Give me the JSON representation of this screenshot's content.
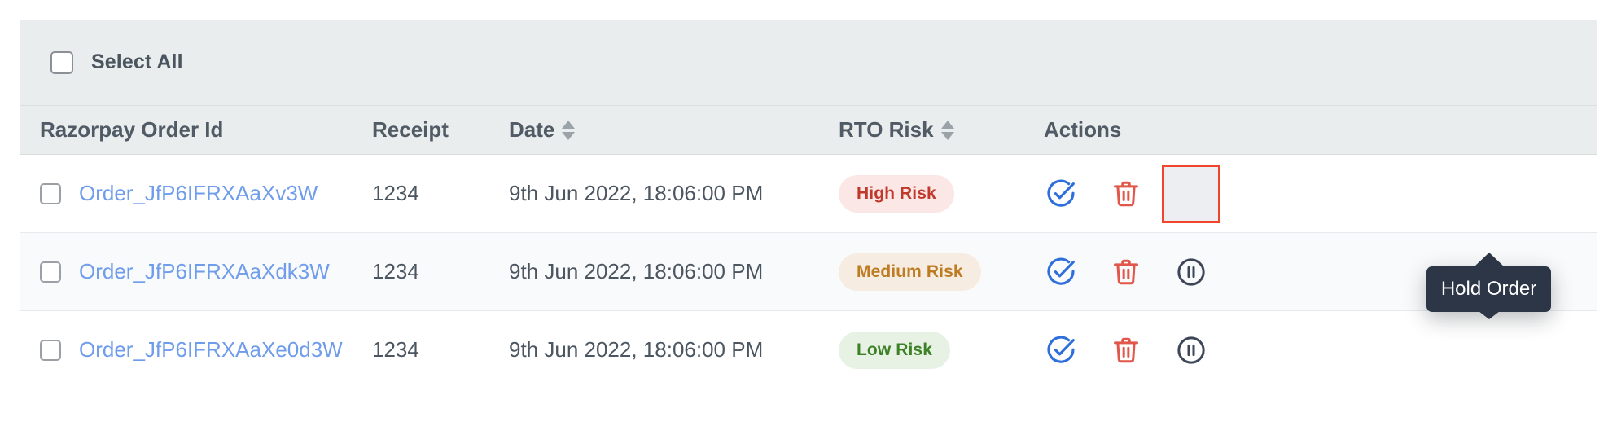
{
  "table": {
    "select_all": {
      "label": "Select All",
      "checked": false
    },
    "columns": [
      {
        "key": "order_id",
        "label": "Razorpay Order Id",
        "sortable": false
      },
      {
        "key": "receipt",
        "label": "Receipt",
        "sortable": false
      },
      {
        "key": "date",
        "label": "Date",
        "sortable": true,
        "sort_icon": "sort-arrows-icon"
      },
      {
        "key": "rto_risk",
        "label": "RTO Risk",
        "sortable": true,
        "sort_icon": "sort-arrows-icon"
      },
      {
        "key": "actions",
        "label": "Actions",
        "sortable": false
      }
    ],
    "rows": [
      {
        "checked": false,
        "order_id": "Order_JfP6IFRXAaXv3W",
        "receipt": "1234",
        "date": "9th Jun 2022, 18:06:00 PM",
        "rto_risk": "High Risk",
        "rto_risk_level": "high",
        "actions": [
          {
            "name": "approve-order-icon",
            "label": "Approve Order"
          },
          {
            "name": "delete-order-icon",
            "label": "Delete Order"
          },
          {
            "name": "hold-order-icon",
            "label": "Hold Order"
          }
        ]
      },
      {
        "checked": false,
        "order_id": "Order_JfP6IFRXAaXdk3W",
        "receipt": "1234",
        "date": "9th Jun 2022, 18:06:00 PM",
        "rto_risk": "Medium Risk",
        "rto_risk_level": "medium",
        "actions": [
          {
            "name": "approve-order-icon",
            "label": "Approve Order"
          },
          {
            "name": "delete-order-icon",
            "label": "Delete Order"
          },
          {
            "name": "hold-order-icon",
            "label": "Hold Order"
          }
        ]
      },
      {
        "checked": false,
        "order_id": "Order_JfP6IFRXAaXe0d3W",
        "receipt": "1234",
        "date": "9th Jun 2022, 18:06:00 PM",
        "rto_risk": "Low Risk",
        "rto_risk_level": "low",
        "actions": [
          {
            "name": "approve-order-icon",
            "label": "Approve Order"
          },
          {
            "name": "delete-order-icon",
            "label": "Delete Order"
          },
          {
            "name": "hold-order-icon",
            "label": "Hold Order"
          }
        ]
      }
    ]
  },
  "tooltip": {
    "text": "Hold Order",
    "attached_to": "hold-order-icon-row-1"
  },
  "highlight": {
    "target": "hold-order-button-row-1",
    "border_color": "#f1452b"
  },
  "colors": {
    "header_band": "#eaeded",
    "row_alt": "#f9fafb",
    "link": "#6f9ceb",
    "approve_icon": "#2f6fdc",
    "delete_icon": "#e2574c",
    "hold_icon": "#3d4659",
    "risk_high_bg": "#fbe7e6",
    "risk_high_text": "#c0392b",
    "risk_medium_bg": "#f6ece1",
    "risk_medium_text": "#bd7b22",
    "risk_low_bg": "#e8f2e4",
    "risk_low_text": "#3c8127",
    "tooltip_bg": "#2d3647",
    "highlight_border": "#f1452b"
  }
}
